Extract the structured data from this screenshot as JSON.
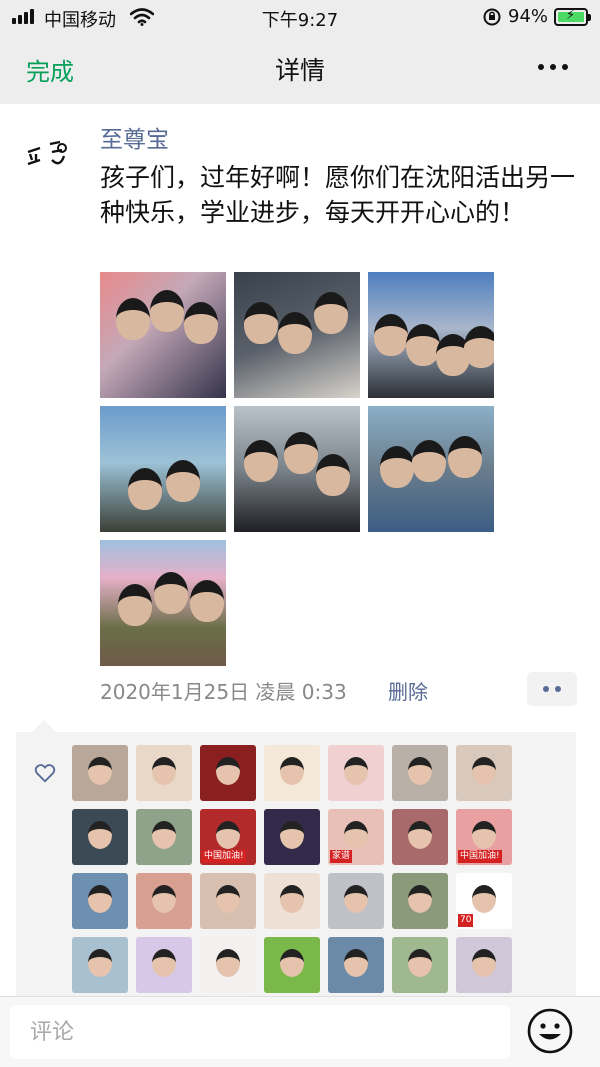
{
  "status_bar": {
    "carrier": "中国移动",
    "time": "下午9:27",
    "battery_percent": "94%",
    "battery_color": "#4cd964",
    "icons": [
      "signal-icon",
      "wifi-icon",
      "orientation-lock-icon",
      "battery-icon"
    ]
  },
  "nav": {
    "done_label": "完成",
    "title": "详情",
    "more_icon": "more-dots-icon",
    "accent": "#07a05a"
  },
  "post": {
    "author": "至尊宝",
    "text": "孩子们，过年好啊！愿你们在沈阳活出另一种快乐，学业进步，每天开开心心的！",
    "timestamp": "2020年1月25日 凌晨 0:33",
    "delete_label": "删除",
    "link_color": "#576b95",
    "photo_count": 7,
    "action_icon": "comment-dots-icon"
  },
  "likes": {
    "icon": "heart-icon",
    "count": 28,
    "badge_labels": [
      "中国加油!",
      "中国加油!",
      "家谱",
      "70"
    ]
  },
  "comment": {
    "placeholder": "评论",
    "emoji_icon": "emoji-icon"
  }
}
